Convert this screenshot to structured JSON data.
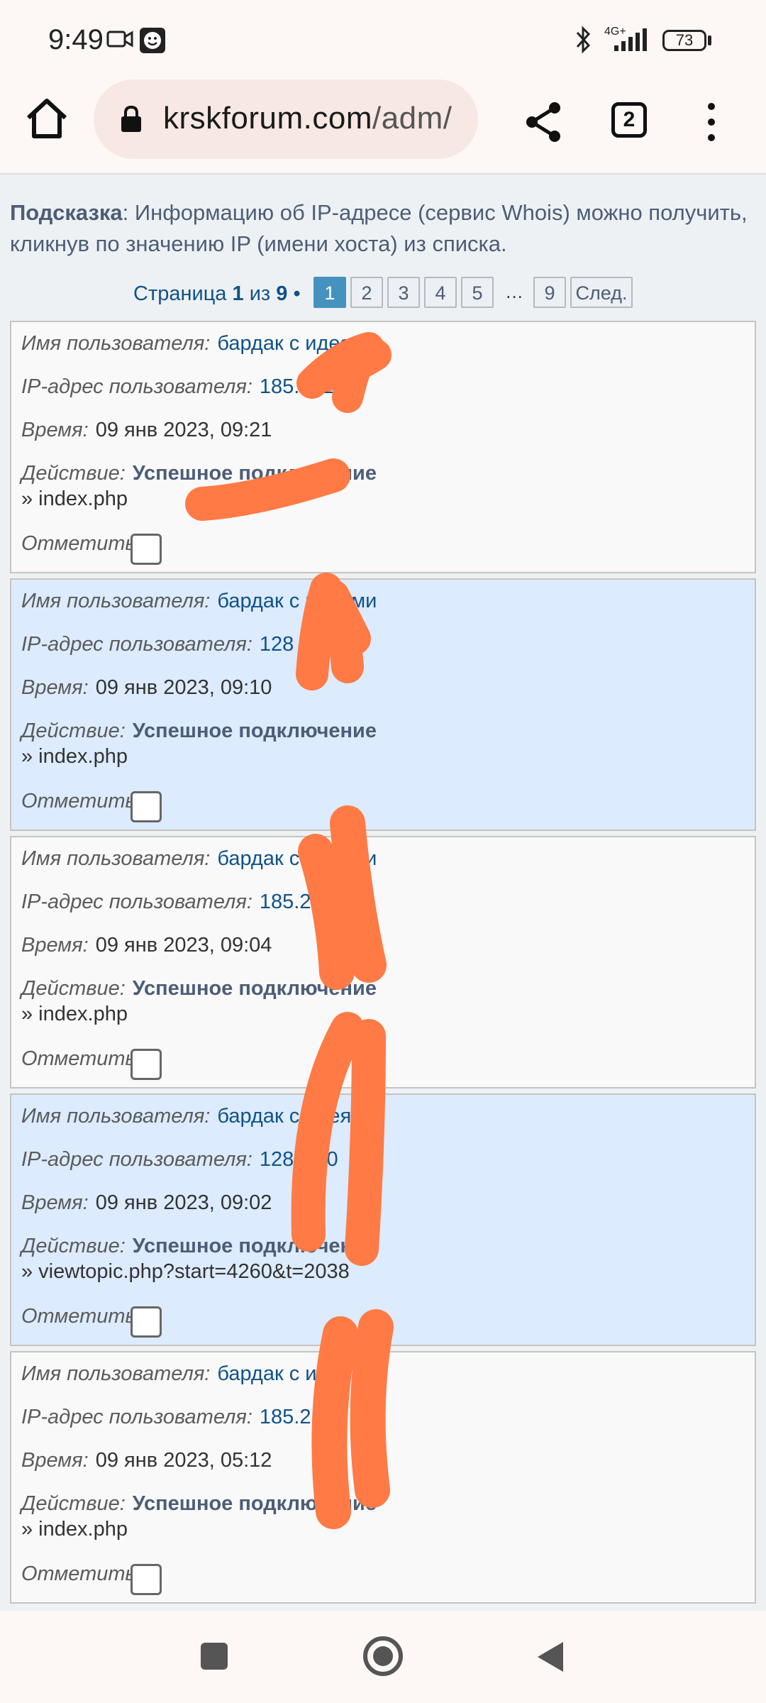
{
  "status_bar": {
    "time": "9:49",
    "network": "4G+",
    "battery": "73",
    "icons": [
      "video-camera-icon",
      "smiley-app-icon",
      "bluetooth-icon",
      "signal-icon"
    ]
  },
  "browser": {
    "url_host": "krskforum.com",
    "url_path": "/adm/",
    "tab_count": "2",
    "icons": [
      "home-icon",
      "lock-icon",
      "share-icon",
      "tabs-icon",
      "more-vert-icon"
    ]
  },
  "hint": {
    "label": "Подсказка",
    "text": ": Информацию об IP-адресе (сервис Whois) можно получить, кликнув по значению IP (имени хоста) из списка."
  },
  "pagination": {
    "prefix": "Страница ",
    "current": "1",
    "of": " из ",
    "total": "9",
    "bullet": " •",
    "pages": [
      "1",
      "2",
      "3",
      "4",
      "5"
    ],
    "ellipsis": "…",
    "last": "9",
    "next": "След."
  },
  "labels": {
    "user": "Имя пользователя:",
    "ip": "IP-адрес пользователя:",
    "time": "Время:",
    "action": "Действие:",
    "mark": "Отметить:"
  },
  "entries": [
    {
      "user": "бардак с идеями",
      "ip": "185.2  .2.4",
      "time": "09 янв 2023, 09:21",
      "action": "Успешное подключение",
      "page": "» index.php"
    },
    {
      "user": "бардак с идеями",
      "ip": "128  .7.110",
      "time": "09 янв 2023, 09:10",
      "action": "Успешное подключение",
      "page": "» index.php"
    },
    {
      "user": "бардак с идеями",
      "ip": "185.2  .4",
      "time": "09 янв 2023, 09:04",
      "action": "Успешное подключение",
      "page": "» index.php"
    },
    {
      "user": "бардак с идеями",
      "ip": "128  .110",
      "time": "09 янв 2023, 09:02",
      "action": "Успешное подключение",
      "page": "» viewtopic.php?start=4260&t=2038"
    },
    {
      "user": "бардак с  и",
      "ip": "185.2  .4",
      "time": "09 янв 2023, 05:12",
      "action": "Успешное подключение",
      "page": "» index.php"
    }
  ],
  "colors": {
    "link": "#105289",
    "row_alt": "#dcebfe",
    "row": "#f9f9f9",
    "active_page": "#4692bf",
    "redaction": "#ff7a45"
  },
  "nav_bar": {
    "icons": [
      "recents-square-icon",
      "home-circle-icon",
      "back-triangle-icon"
    ]
  }
}
